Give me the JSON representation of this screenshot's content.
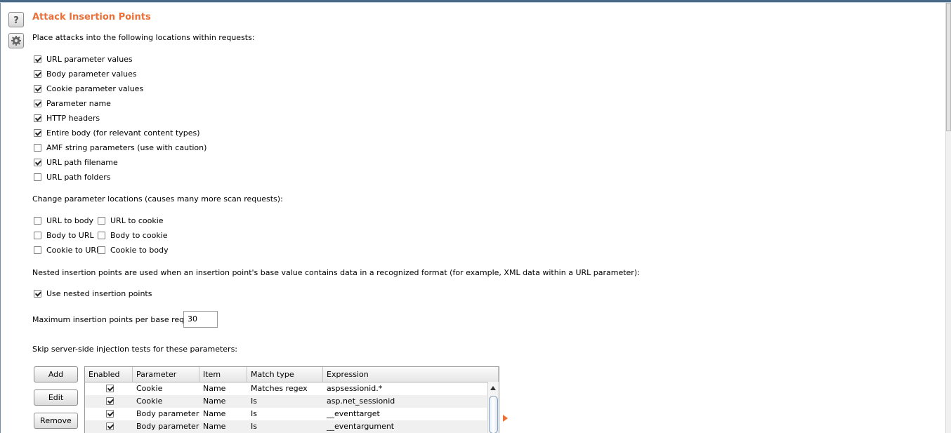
{
  "section": {
    "title": "Attack Insertion Points",
    "intro": "Place attacks into the following locations within requests:"
  },
  "locations": [
    {
      "label": "URL parameter values",
      "checked": true
    },
    {
      "label": "Body parameter values",
      "checked": true
    },
    {
      "label": "Cookie parameter values",
      "checked": true
    },
    {
      "label": "Parameter name",
      "checked": true
    },
    {
      "label": "HTTP headers",
      "checked": true
    },
    {
      "label": "Entire body (for relevant content types)",
      "checked": true
    },
    {
      "label": "AMF string parameters (use with caution)",
      "checked": false
    },
    {
      "label": "URL path filename",
      "checked": true
    },
    {
      "label": "URL path folders",
      "checked": false
    }
  ],
  "change_locations": {
    "label": "Change parameter locations (causes many more scan requests):",
    "options": [
      {
        "label": "URL to body",
        "checked": false
      },
      {
        "label": "URL to cookie",
        "checked": false
      },
      {
        "label": "Body to URL",
        "checked": false
      },
      {
        "label": "Body to cookie",
        "checked": false
      },
      {
        "label": "Cookie to URL",
        "checked": false
      },
      {
        "label": "Cookie to body",
        "checked": false
      }
    ]
  },
  "nested": {
    "label": "Nested insertion points are used when an insertion point's base value contains data in a recognized format (for example, XML data within a URL parameter):",
    "option": {
      "label": "Use nested insertion points",
      "checked": true
    }
  },
  "max_points": {
    "label": "Maximum insertion points per base request:",
    "value": "30"
  },
  "skip": {
    "label": "Skip server-side injection tests for these parameters:",
    "buttons": {
      "add": "Add",
      "edit": "Edit",
      "remove": "Remove"
    },
    "columns": [
      "Enabled",
      "Parameter",
      "Item",
      "Match type",
      "Expression"
    ],
    "rows": [
      {
        "enabled": true,
        "parameter": "Cookie",
        "item": "Name",
        "match_type": "Matches regex",
        "expression": "aspsessionid.*"
      },
      {
        "enabled": true,
        "parameter": "Cookie",
        "item": "Name",
        "match_type": "Is",
        "expression": "asp.net_sessionid"
      },
      {
        "enabled": true,
        "parameter": "Body parameter",
        "item": "Name",
        "match_type": "Is",
        "expression": "__eventtarget"
      },
      {
        "enabled": true,
        "parameter": "Body parameter",
        "item": "Name",
        "match_type": "Is",
        "expression": "__eventargument"
      }
    ]
  },
  "icons": {
    "help": "help-icon",
    "settings": "gear-icon"
  },
  "colors": {
    "accent": "#e8703a"
  }
}
